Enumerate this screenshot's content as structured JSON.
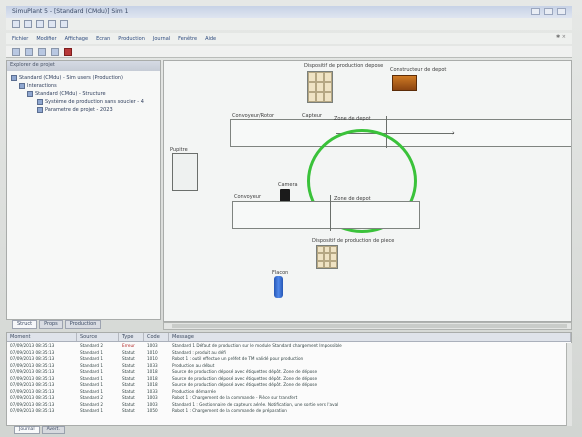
{
  "window": {
    "title": "SimuPlant 5 - [Standard (CMdu)] Sim 1"
  },
  "menu": [
    "Fichier",
    "Modifier",
    "Affichage",
    "Ecran",
    "Production",
    "Journal",
    "Fenêtre",
    "Aide"
  ],
  "tree": {
    "header": "Explorer de projet",
    "nodes": [
      "Standard (CMdu) - Sim users (Production)",
      "Interactions",
      "Standard (CMdu) - Structure",
      "Système de production sans soucier - 4",
      "Parametre de projet - 2023"
    ]
  },
  "left_tabs": [
    "Struct",
    "Props",
    "Production"
  ],
  "canvas": {
    "labels": {
      "top_stack": "Dispositif de production depose",
      "orange_box": "Constructeur de depot",
      "conveyor1": "Convoyeur/Rotor",
      "capture": "Capteur",
      "camera": "Camera",
      "conveyor2": "Convoyeur",
      "zone": "Zone de depot",
      "bottom_stack": "Dispositif de production de piece",
      "bottle": "Flacon",
      "smallpanel": "Pupitre"
    }
  },
  "log": {
    "columns": [
      "Moment",
      "Source",
      "Type",
      "Code",
      "Message"
    ],
    "rows": [
      [
        "07/09/2013 08:35:13",
        "Standard 2",
        "Erreur",
        "1003",
        "Standard 1 Défaut de production sur le module Standard chargement Impossible"
      ],
      [
        "07/09/2013 08:35:13",
        "Standard 1",
        "Statut",
        "1010",
        "Standard : produit au défi"
      ],
      [
        "07/09/2013 08:35:13",
        "Standard 1",
        "Statut",
        "1010",
        "Robot 1 : outil effectue un préfet de TM validé pour production"
      ],
      [
        "07/09/2013 08:35:13",
        "Standard 1",
        "Statut",
        "1033",
        "Production au début"
      ],
      [
        "07/09/2013 08:35:13",
        "Standard 1",
        "Statut",
        "1018",
        "Source de production déposé avec étiquettes dépôt. Zone de dépose"
      ],
      [
        "07/09/2013 08:35:13",
        "Standard 1",
        "Statut",
        "1018",
        "Source de production déposé avec étiquettes dépôt. Zone de dépose"
      ],
      [
        "07/09/2013 08:35:13",
        "Standard 1",
        "Statut",
        "1018",
        "Source de production déposé avec étiquettes dépôt. Zone de dépose"
      ],
      [
        "07/09/2013 08:35:13",
        "Standard 1",
        "Statut",
        "1033",
        "Production démarrée"
      ],
      [
        "07/09/2013 08:35:13",
        "Standard 2",
        "Statut",
        "1003",
        "Robot 1 : Chargement de la commande - Pièce sur transfert"
      ],
      [
        "07/09/2013 08:35:13",
        "Standard 2",
        "Statut",
        "1003",
        "Standard 1 : Gestionnaire de capteurs aérée. Notification, une sortie vers l'aval"
      ],
      [
        "07/09/2013 08:35:13",
        "Standard 1",
        "Statut",
        "1050",
        "Robot 1 : Chargement de la commande de préparation"
      ]
    ]
  },
  "bottom_tabs": [
    "Journal",
    "Avert."
  ]
}
